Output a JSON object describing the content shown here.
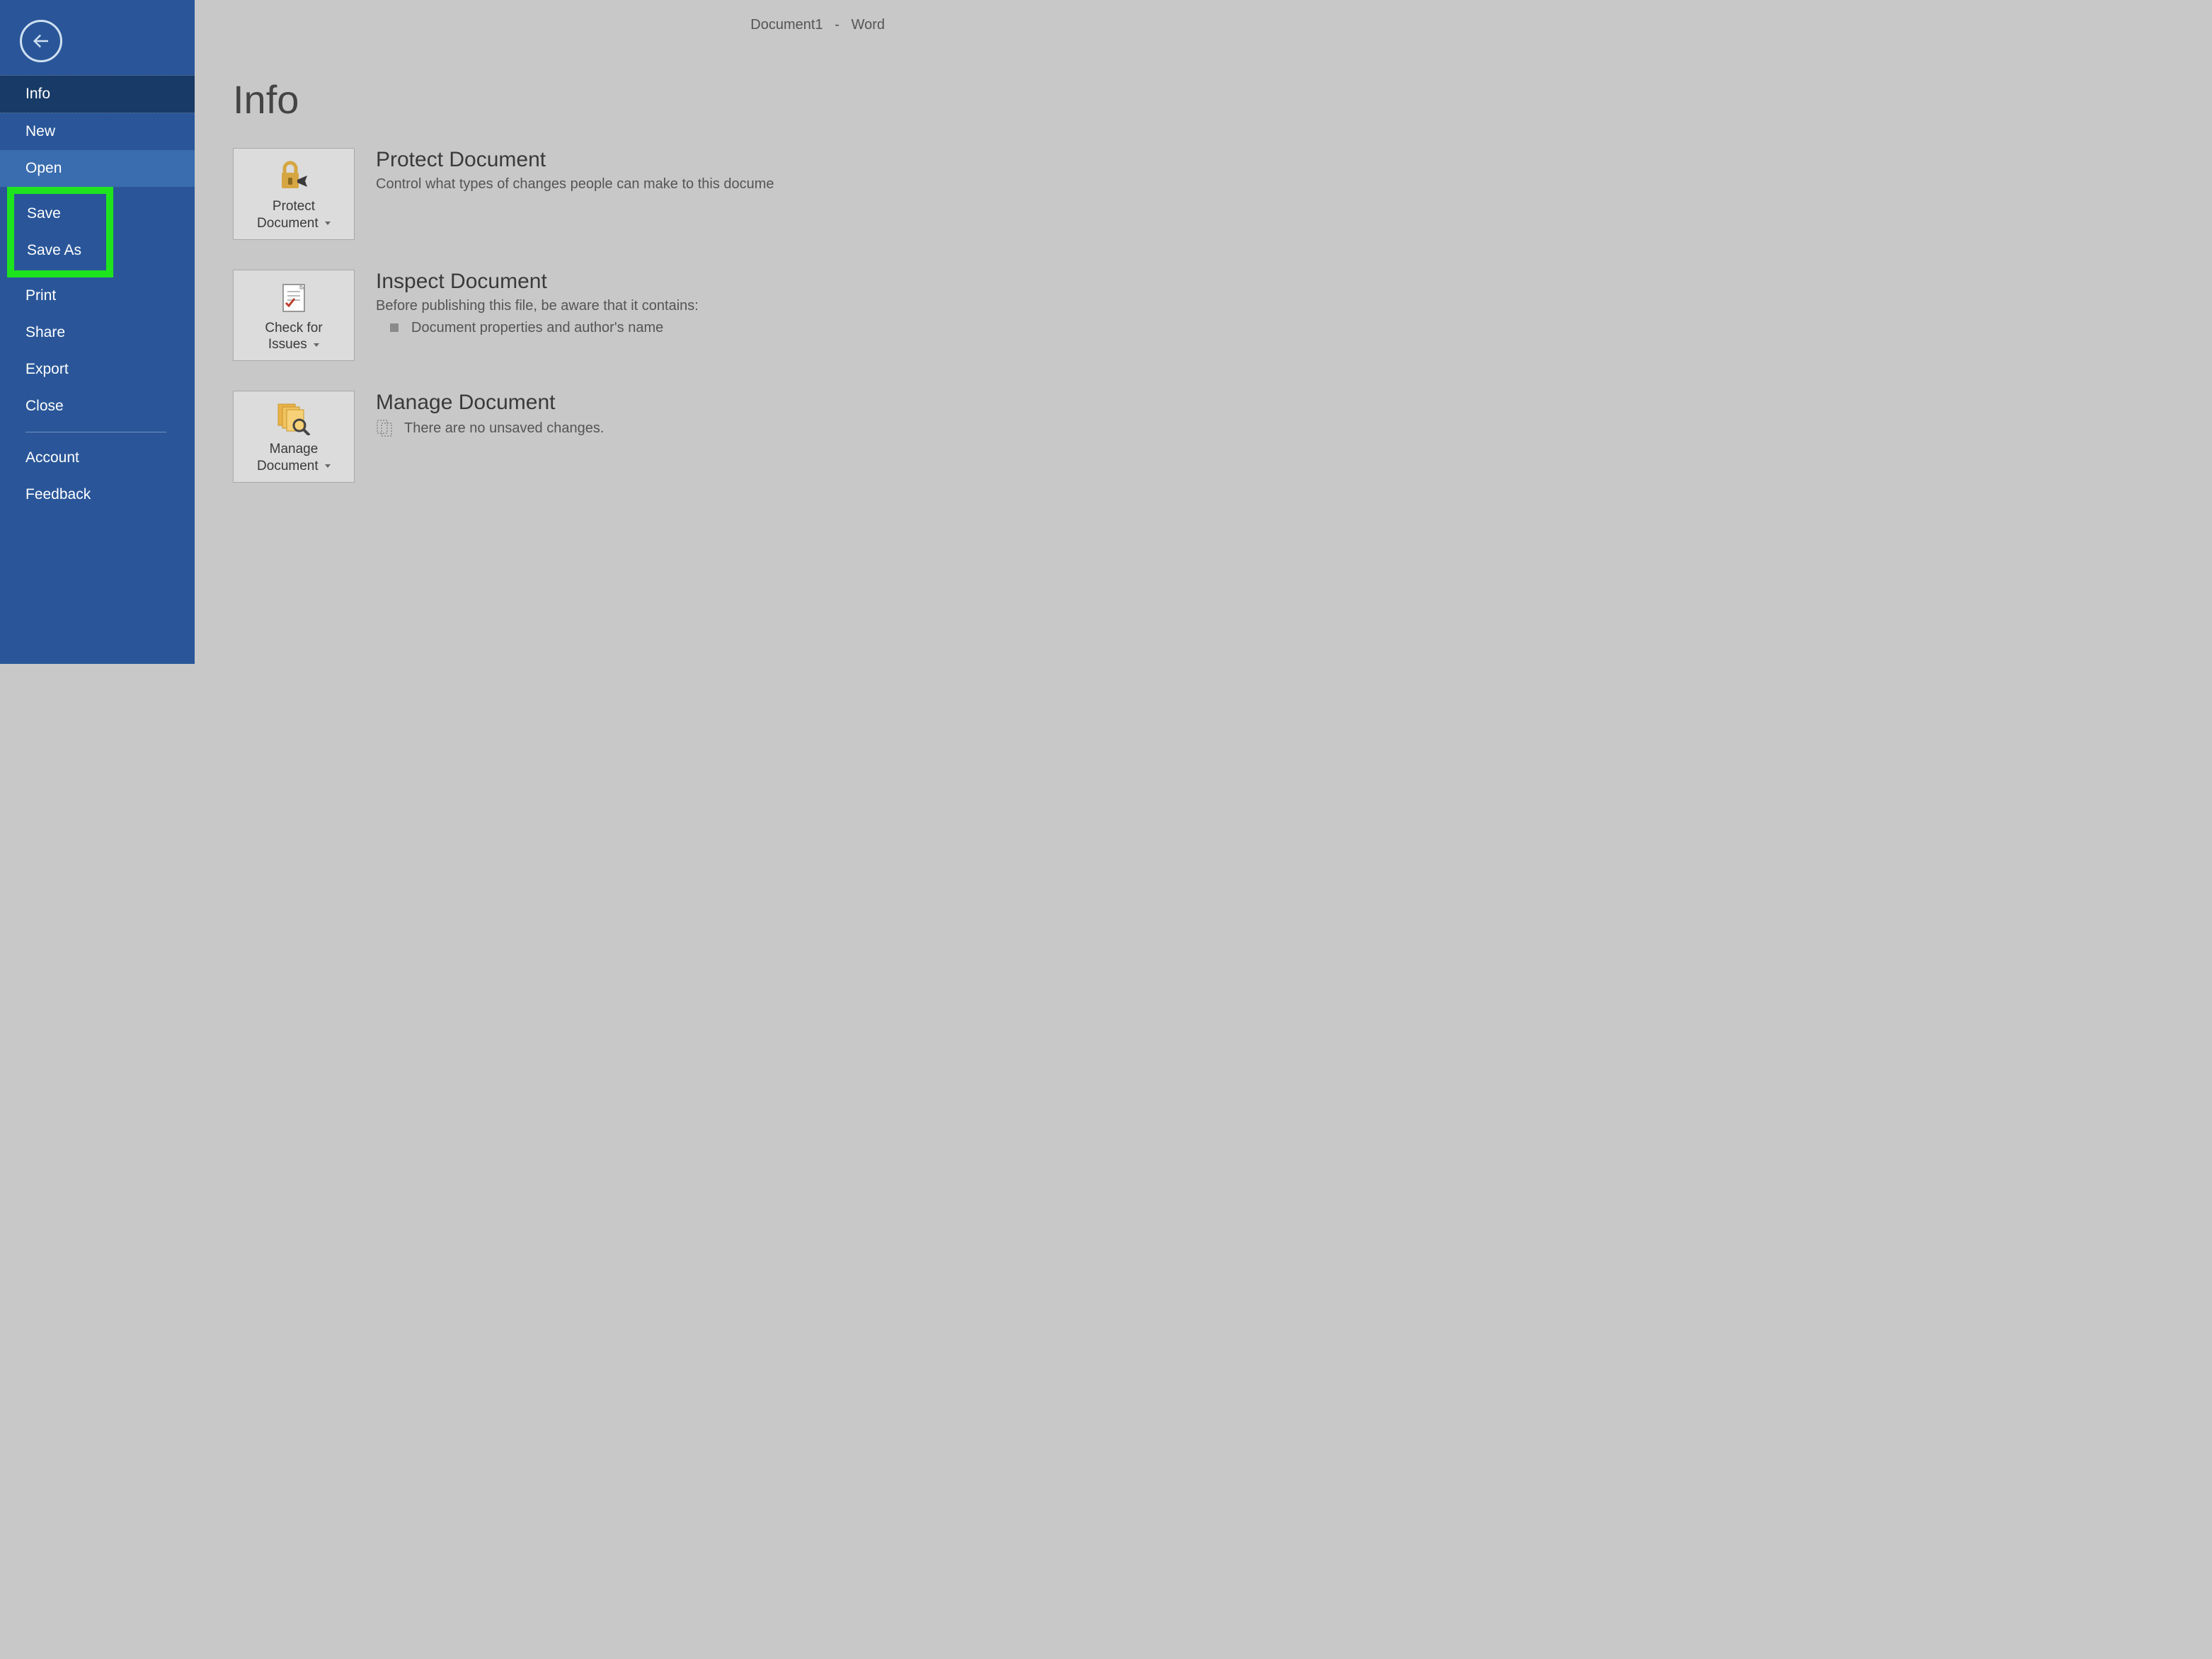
{
  "titlebar": {
    "doc": "Document1",
    "app": "Word"
  },
  "sidebar": {
    "items": [
      {
        "label": "Info",
        "name": "nav-info"
      },
      {
        "label": "New",
        "name": "nav-new"
      },
      {
        "label": "Open",
        "name": "nav-open"
      },
      {
        "label": "Save",
        "name": "nav-save"
      },
      {
        "label": "Save As",
        "name": "nav-save-as"
      },
      {
        "label": "Print",
        "name": "nav-print"
      },
      {
        "label": "Share",
        "name": "nav-share"
      },
      {
        "label": "Export",
        "name": "nav-export"
      },
      {
        "label": "Close",
        "name": "nav-close"
      },
      {
        "label": "Account",
        "name": "nav-account"
      },
      {
        "label": "Feedback",
        "name": "nav-feedback"
      }
    ]
  },
  "page": {
    "title": "Info"
  },
  "sections": {
    "protect": {
      "tile_label": "Protect\nDocument",
      "heading": "Protect Document",
      "desc": "Control what types of changes people can make to this docume"
    },
    "inspect": {
      "tile_label": "Check for\nIssues",
      "heading": "Inspect Document",
      "desc": "Before publishing this file, be aware that it contains:",
      "bullet": "Document properties and author's name"
    },
    "manage": {
      "tile_label": "Manage\nDocument",
      "heading": "Manage Document",
      "desc": "There are no unsaved changes."
    }
  }
}
